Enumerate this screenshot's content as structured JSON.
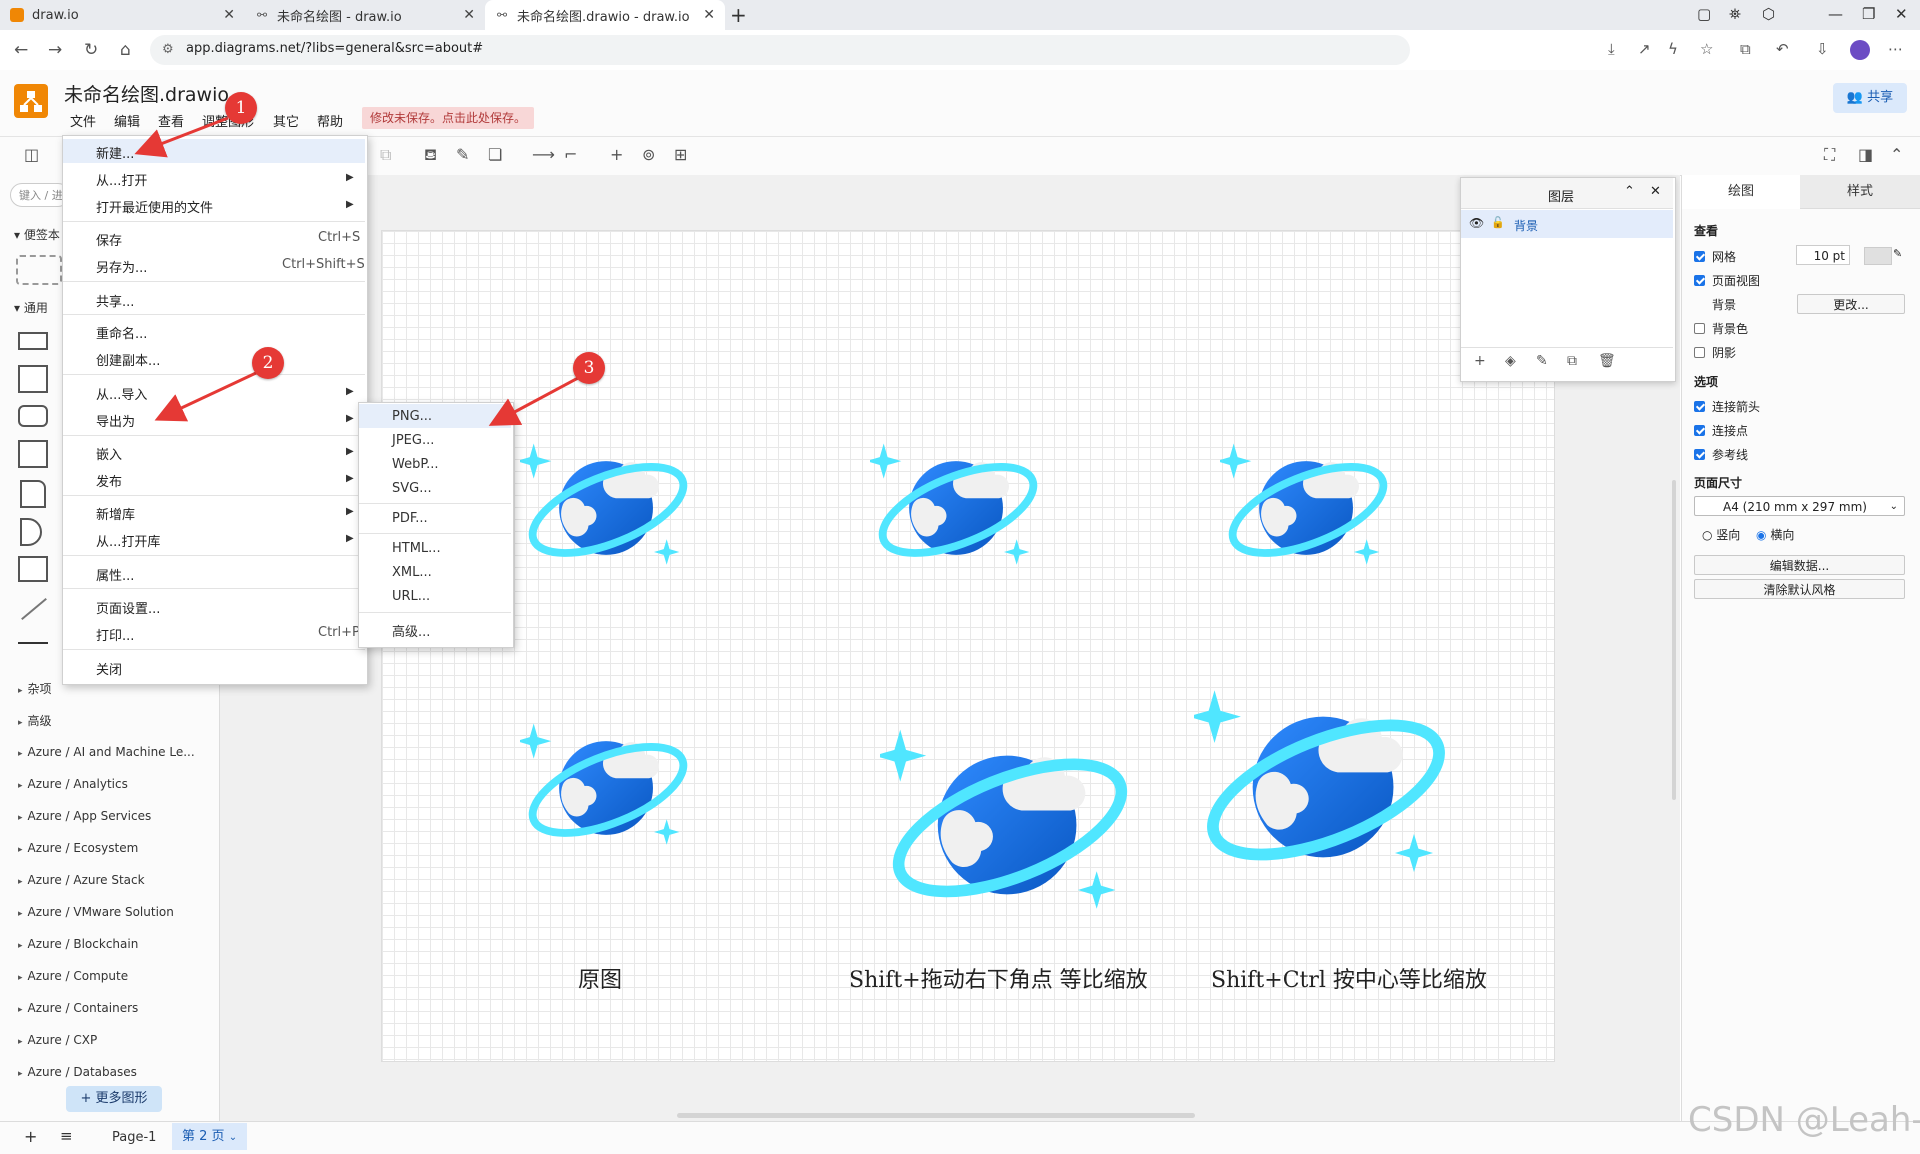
{
  "browser": {
    "tabs": [
      {
        "title": "draw.io"
      },
      {
        "title": "未命名绘图 - draw.io"
      },
      {
        "title": "未命名绘图.drawio - draw.io"
      }
    ],
    "url": "app.diagrams.net/?libs=general&src=about#"
  },
  "app": {
    "doc_title": "未命名绘图.drawio",
    "menu": [
      "文件",
      "编辑",
      "查看",
      "调整图形",
      "其它",
      "帮助"
    ],
    "unsaved_notice": "修改未保存。点击此处保存。",
    "share_label": "共享"
  },
  "sidebar": {
    "search_placeholder": "键入 / 进",
    "sections": [
      "便签本",
      "通用"
    ],
    "libraries": [
      "杂项",
      "高级",
      "Azure / AI and Machine Le...",
      "Azure / Analytics",
      "Azure / App Services",
      "Azure / Ecosystem",
      "Azure / Azure Stack",
      "Azure / VMware Solution",
      "Azure / Blockchain",
      "Azure / Compute",
      "Azure / Containers",
      "Azure / CXP",
      "Azure / Databases"
    ],
    "more_shapes": "更多图形"
  },
  "file_menu": {
    "items": [
      {
        "label": "新建...",
        "shortcut": ""
      },
      {
        "label": "从...打开",
        "shortcut": ""
      },
      {
        "label": "打开最近使用的文件",
        "shortcut": ""
      },
      {
        "label": "保存",
        "shortcut": "Ctrl+S"
      },
      {
        "label": "另存为...",
        "shortcut": "Ctrl+Shift+S"
      },
      {
        "label": "共享...",
        "shortcut": ""
      },
      {
        "label": "重命名...",
        "shortcut": ""
      },
      {
        "label": "创建副本...",
        "shortcut": ""
      },
      {
        "label": "从...导入",
        "shortcut": ""
      },
      {
        "label": "导出为",
        "shortcut": ""
      },
      {
        "label": "嵌入",
        "shortcut": ""
      },
      {
        "label": "发布",
        "shortcut": ""
      },
      {
        "label": "新增库",
        "shortcut": ""
      },
      {
        "label": "从...打开库",
        "shortcut": ""
      },
      {
        "label": "属性...",
        "shortcut": ""
      },
      {
        "label": "页面设置...",
        "shortcut": ""
      },
      {
        "label": "打印...",
        "shortcut": "Ctrl+P"
      },
      {
        "label": "关闭",
        "shortcut": ""
      }
    ]
  },
  "export_menu": {
    "items": [
      "PNG...",
      "JPEG...",
      "WebP...",
      "SVG...",
      "PDF...",
      "HTML...",
      "XML...",
      "URL...",
      "高级..."
    ]
  },
  "markers": [
    "1",
    "2",
    "3"
  ],
  "canvas": {
    "captions": [
      "原图",
      "Shift+拖动右下角点  等比缩放",
      "Shift+Ctrl  按中心等比缩放"
    ]
  },
  "layers": {
    "title": "图层",
    "layer_name": "背景"
  },
  "format_panel": {
    "tabs": [
      "绘图",
      "样式"
    ],
    "view_heading": "查看",
    "grid_label": "网格",
    "grid_size": "10 pt",
    "page_view_label": "页面视图",
    "background_label": "背景",
    "change_button": "更改...",
    "bg_color_label": "背景色",
    "shadow_label": "阴影",
    "options_heading": "选项",
    "connection_arrows": "连接箭头",
    "connection_points": "连接点",
    "guides": "参考线",
    "page_size_heading": "页面尺寸",
    "page_size_value": "A4 (210 mm x 297 mm)",
    "portrait": "竖向",
    "landscape": "横向",
    "edit_data": "编辑数据...",
    "clear_style": "清除默认风格"
  },
  "bottom": {
    "pages": [
      "Page-1",
      "第 2 页"
    ]
  },
  "watermark": "CSDN @Leah-",
  "colors": {
    "accent": "#1a73e8",
    "brand": "#f08705",
    "marker": "#e53935",
    "planet_ring": "#50e6ff"
  }
}
